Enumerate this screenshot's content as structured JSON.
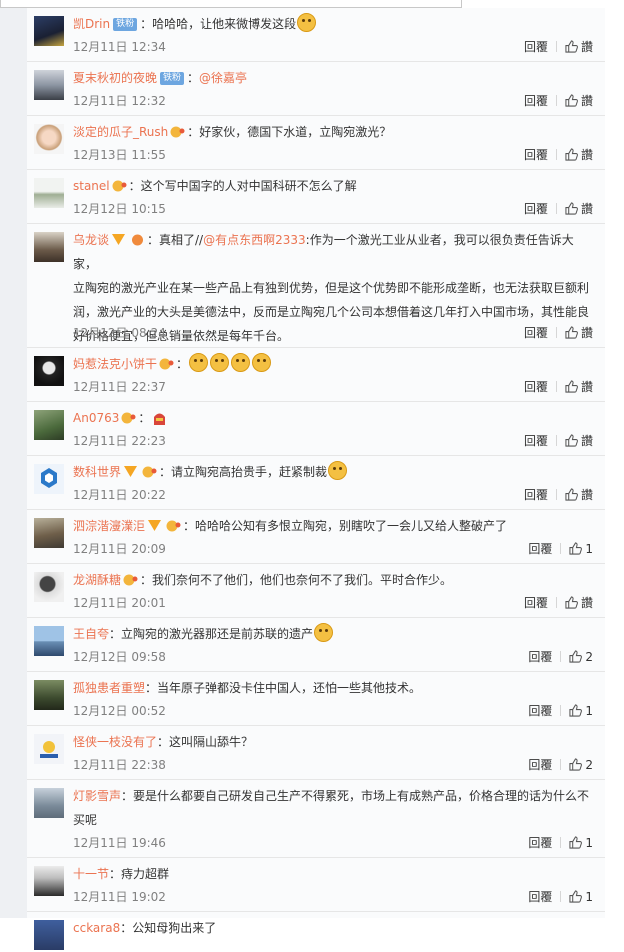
{
  "actions": {
    "reply_label": "回覆",
    "like_label": "讚"
  },
  "comments": [
    {
      "user": "凯Drin",
      "badge": "铁粉",
      "text": "：哈哈哈，让他来微博发这段",
      "time": "12月11日 12:34",
      "likes": ""
    },
    {
      "user": "夏末秋初的夜晚",
      "badge": "铁粉",
      "text": "：",
      "mention": "@徐嘉亭",
      "time": "12月11日 12:32",
      "likes": ""
    },
    {
      "user": "淡定的瓜子_Rush",
      "text": "：好家伙，德国下水道，立陶宛激光？",
      "time": "12月13日 11:55",
      "likes": ""
    },
    {
      "user": "stanel",
      "text": "：这个写中国字的人对中国科研不怎么了解",
      "time": "12月12日 10:15",
      "likes": ""
    },
    {
      "user": "乌龙谈",
      "text_before": "：真相了//",
      "mention": "@有点东西啊2333",
      "text_after": ":作为一个激光工业从业者，我可以很负责任告诉大家，",
      "lines": [
        "立陶宛的激光产业在某一些产品上有独到优势，但是这个优势即不能形成垄断，也无法获取巨额利",
        "润，激光产业的大头是美德法中，反而是立陶宛几个公司本想借着这几年打入中国市场，其性能良",
        "好价格便宜，但总销量依然是每年千台。"
      ],
      "time": "12月12日 08:24",
      "likes": ""
    },
    {
      "user": "妈惹法克小饼干",
      "text": "：",
      "time": "12月11日 22:37",
      "likes": ""
    },
    {
      "user": "An0763",
      "text": "：",
      "time": "12月11日 22:23",
      "likes": ""
    },
    {
      "user": "数科世界",
      "text": "：请立陶宛高抬贵手，赶紧制裁",
      "time": "12月11日 20:22",
      "likes": ""
    },
    {
      "user": "泗淙湝濅澲洰",
      "text": "：哈哈哈公知有多恨立陶宛，别瞎吹了一会儿又给人整破产了",
      "time": "12月11日 20:09",
      "likes": "1"
    },
    {
      "user": "龙湖酥糖",
      "text": "：我们奈何不了他们，他们也奈何不了我们。平时合作少。",
      "time": "12月11日 20:01",
      "likes": ""
    },
    {
      "user": "王自夸",
      "text": "：立陶宛的激光器那还是前苏联的遗产",
      "time": "12月12日 09:58",
      "likes": "2"
    },
    {
      "user": "孤独患者重塑",
      "text": "：当年原子弹都没卡住中国人，还怕一些其他技术。",
      "time": "12月12日 00:52",
      "likes": "1"
    },
    {
      "user": "怪侠一枝没有了",
      "text": "：这叫隔山舔牛？",
      "time": "12月11日 22:38",
      "likes": "2"
    },
    {
      "user": "灯影雪声",
      "text": "：要是什么都要自己研发自己生产不得累死，市场上有成熟产品，价格合理的话为什么不",
      "lines": [
        "买呢"
      ],
      "time": "12月11日 19:46",
      "likes": "1"
    },
    {
      "user": "十一节",
      "text": "：痔力超群",
      "time": "12月11日 19:02",
      "likes": "1"
    },
    {
      "user": "cckara8",
      "text": "：公知母狗出来了",
      "time": "",
      "likes": ""
    }
  ],
  "colors": {
    "accent": "#eb7350",
    "badge": "#6da6e0",
    "meta": "#808080"
  }
}
